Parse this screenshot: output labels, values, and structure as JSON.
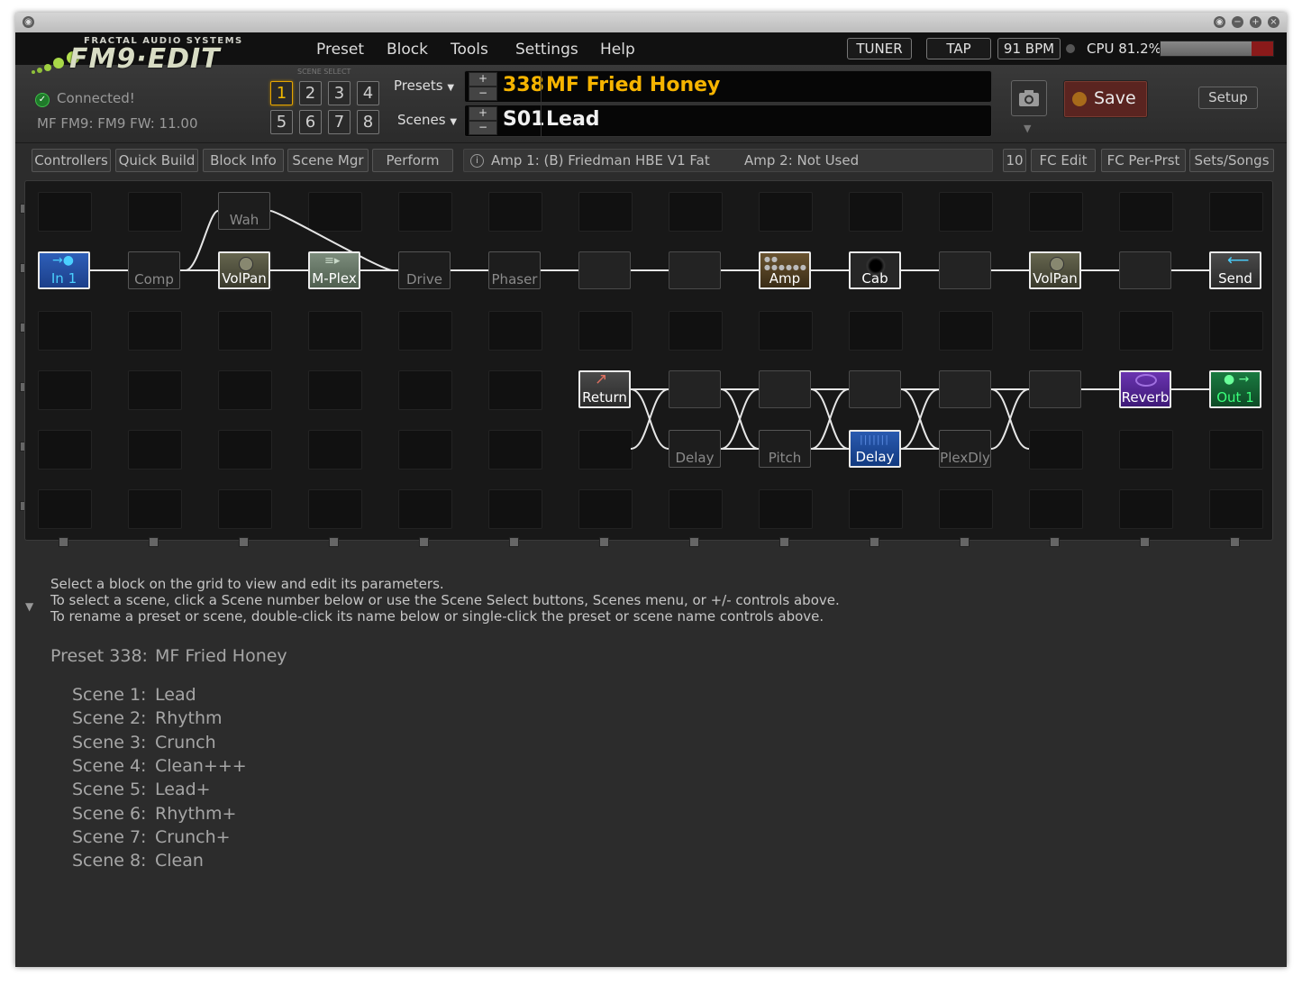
{
  "header": {
    "brand_small": "FRACTAL AUDIO SYSTEMS",
    "brand_big": "FM9·EDIT",
    "menu": [
      "Preset",
      "Block",
      "Tools",
      "Settings",
      "Help"
    ],
    "tuner_label": "TUNER",
    "tap_label": "TAP",
    "bpm": "91 BPM",
    "cpu": "CPU 81.2%",
    "cpu_percent": 81.2,
    "connected": "Connected!",
    "firmware": "MF FM9: FM9 FW: 11.00",
    "scene_select_label": "SCENE SELECT",
    "scene_buttons": [
      "1",
      "2",
      "3",
      "4",
      "5",
      "6",
      "7",
      "8"
    ],
    "active_scene": "1",
    "presets_label": "Presets",
    "scenes_label": "Scenes",
    "preset_number": "338",
    "preset_name": "MF Fried Honey",
    "scene_number": "S01",
    "scene_name": "Lead",
    "save_label": "Save",
    "setup_label": "Setup",
    "camera_icon": "camera-icon"
  },
  "toolbar": {
    "tabs": [
      "Controllers",
      "Quick Build",
      "Block Info",
      "Scene Mgr",
      "Perform"
    ],
    "amp_info": "Amp 1: (B) Friedman HBE V1 Fat",
    "amp2_info": "Amp 2: Not Used",
    "fc_number": "10",
    "right_tabs": [
      "FC Edit",
      "FC Per-Prst",
      "Sets/Songs"
    ]
  },
  "grid": {
    "blocks": [
      {
        "label": "In 1",
        "state": "on",
        "color": "#2a6fd0",
        "text": "#4ad0ff"
      },
      {
        "label": "Comp",
        "state": "bypass"
      },
      {
        "label": "Wah",
        "state": "bypass"
      },
      {
        "label": "VolPan",
        "state": "on",
        "color": "#4a4a3a"
      },
      {
        "label": "M-Plex",
        "state": "on",
        "color": "#5a6a5a"
      },
      {
        "label": "Drive",
        "state": "bypass"
      },
      {
        "label": "Phaser",
        "state": "bypass"
      },
      {
        "label": "Amp",
        "state": "on",
        "color": "#4a3a20"
      },
      {
        "label": "Cab",
        "state": "on",
        "color": "#2a2a2a"
      },
      {
        "label": "VolPan",
        "state": "on",
        "color": "#4a4a3a"
      },
      {
        "label": "Send",
        "state": "on",
        "color": "#3a3a3a"
      },
      {
        "label": "Return",
        "state": "on",
        "color": "#3a3a3a"
      },
      {
        "label": "Delay",
        "state": "bypass"
      },
      {
        "label": "Pitch",
        "state": "bypass"
      },
      {
        "label": "Delay",
        "state": "on",
        "color": "#1e4a9a"
      },
      {
        "label": "PlexDly",
        "state": "bypass"
      },
      {
        "label": "Reverb",
        "state": "on",
        "color": "#5a2aa0"
      },
      {
        "label": "Out 1",
        "state": "on",
        "color": "#1a6a3a",
        "text": "#3aff7a"
      }
    ]
  },
  "help": {
    "lines": [
      "Select a block on the grid to view and edit its parameters.",
      "To select a scene, click a Scene number below or use the Scene Select buttons, Scenes menu, or +/- controls above.",
      "To rename a preset or scene, double-click its name below or single-click the preset or scene name controls above."
    ]
  },
  "preset_info": {
    "preset_label": "Preset 338:",
    "preset_name": "MF Fried Honey",
    "scenes": [
      {
        "label": "Scene 1:",
        "name": "Lead"
      },
      {
        "label": "Scene 2:",
        "name": "Rhythm"
      },
      {
        "label": "Scene 3:",
        "name": "Crunch"
      },
      {
        "label": "Scene 4:",
        "name": "Clean+++"
      },
      {
        "label": "Scene 5:",
        "name": "Lead+"
      },
      {
        "label": "Scene 6:",
        "name": "Rhythm+"
      },
      {
        "label": "Scene 7:",
        "name": "Crunch+"
      },
      {
        "label": "Scene 8:",
        "name": "Clean"
      }
    ]
  }
}
